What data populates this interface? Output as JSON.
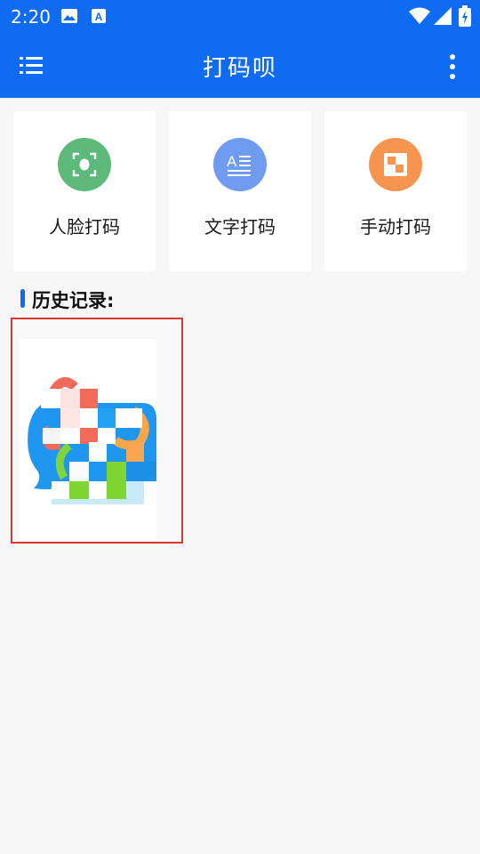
{
  "status_bar": {
    "time": "2:20",
    "icons": [
      "image-icon",
      "a-notification-icon",
      "wifi-icon",
      "signal-icon",
      "battery-charging-icon"
    ]
  },
  "app_bar": {
    "title": "打码呗",
    "menu_icon": "list-menu-icon",
    "more_icon": "more-vert-icon",
    "color": "#0f6cf2"
  },
  "features": [
    {
      "label": "人脸打码",
      "icon": "face-scan-icon",
      "color": "#5cb97a"
    },
    {
      "label": "文字打码",
      "icon": "text-icon",
      "color": "#6f9cf0"
    },
    {
      "label": "手动打码",
      "icon": "mosaic-icon",
      "color": "#f7944f"
    }
  ],
  "history": {
    "title": "历史记录:",
    "items": [
      {
        "name": "mosaic-image-thumbnail"
      }
    ]
  }
}
